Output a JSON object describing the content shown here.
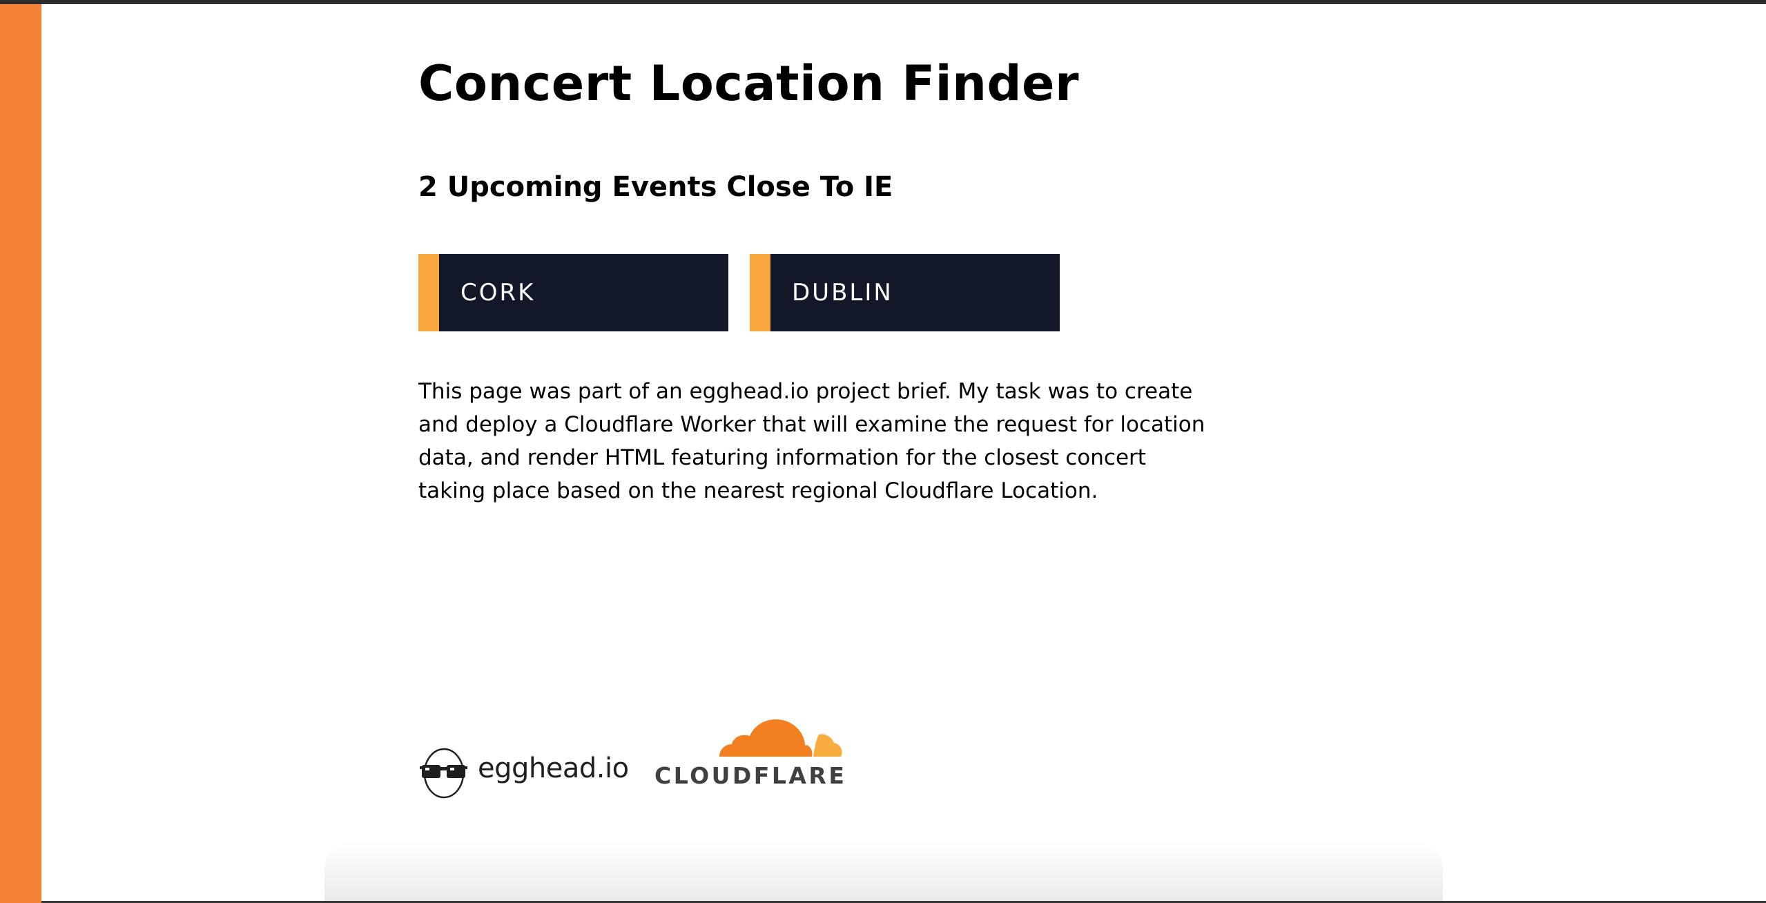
{
  "page": {
    "title": "Concert Location Finder",
    "subtitle": "2 Upcoming Events Close To IE",
    "events": [
      {
        "label": "CORK"
      },
      {
        "label": "DUBLIN"
      }
    ],
    "description": "This page was part of an egghead.io project brief. My task was to create and deploy a Cloudflare Worker that will examine the request for location data, and render HTML featuring information for the closest concert taking place based on the nearest regional Cloudflare Location."
  },
  "logos": {
    "egghead": {
      "text": "egghead.io",
      "icon": "egghead-glasses-icon"
    },
    "cloudflare": {
      "text": "CLOUDFLARE",
      "icon": "cloudflare-cloud-icon"
    }
  },
  "colors": {
    "left_bar": "#f38237",
    "card_background": "#121827",
    "card_accent": "#f7a73d",
    "cloudflare_orange": "#f38020",
    "cloudflare_light_orange": "#faad3f"
  }
}
